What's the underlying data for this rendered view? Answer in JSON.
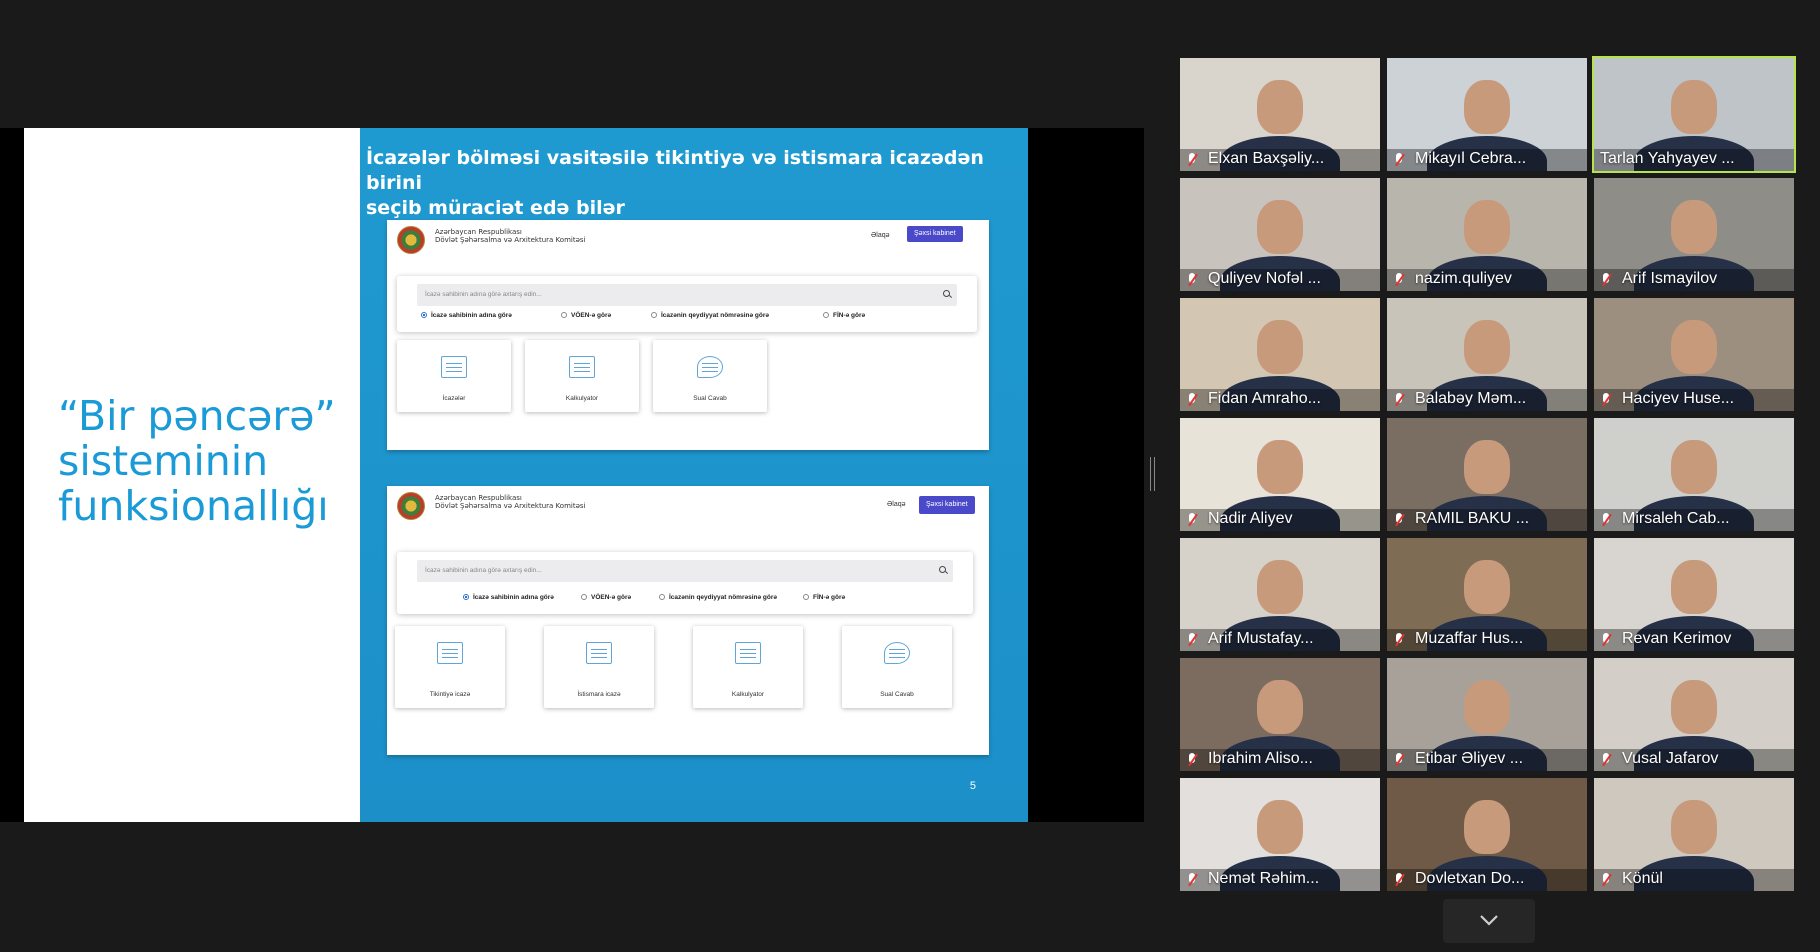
{
  "slide": {
    "title_lines": [
      "“Bir pəncərə”",
      "sisteminin",
      "funksionallığı"
    ],
    "heading_lines": [
      "İcazələr bölməsi vasitəsilə tikintiyə və istismara icazədən birini",
      "seçib müraciət edə bilər"
    ],
    "page_number": "5",
    "mock1": {
      "org_line1": "Azərbaycan Respublikası",
      "org_line2": "Dövlət Şəhərsalma və Arxitektura Komitəsi",
      "contact": "Əlaqə",
      "cabinet": "Şəxsi kabinet",
      "search_placeholder": "İcazə sahibinin adına görə axtarış edin...",
      "radios": [
        "İcazə sahibinin adına görə",
        "VÖEN-ə görə",
        "İcazənin qeydiyyat nömrəsinə görə",
        "FİN-ə görə"
      ],
      "tiles": [
        "İcazələr",
        "Kalkulyator",
        "Sual Cavab"
      ]
    },
    "mock2": {
      "org_line1": "Azərbaycan Respublikası",
      "org_line2": "Dövlət Şəhərsalma və Arxitektura Komitəsi",
      "contact": "Əlaqə",
      "cabinet": "Şəxsi kabinet",
      "search_placeholder": "İcazə sahibinin adına görə axtarış edin...",
      "radios": [
        "İcazə sahibinin adına görə",
        "VÖEN-ə görə",
        "İcazənin qeydiyyat nömrəsinə görə",
        "FİN-ə görə"
      ],
      "tiles": [
        "Tikintiyə icazə",
        "İstismara icazə",
        "Kalkulyator",
        "Sual Cavab"
      ]
    }
  },
  "participants": [
    {
      "name": "Elxan Baxşəliy...",
      "bg": "#d9d4cc",
      "muted": true
    },
    {
      "name": "Mikayıl Cebra...",
      "bg": "#cdd2d6",
      "muted": true
    },
    {
      "name": "Tarlan Yahyayev ...",
      "bg": "#bfc4c9",
      "muted": false,
      "active": true
    },
    {
      "name": "Quliyev Nofəl ...",
      "bg": "#c9c3bd",
      "muted": true
    },
    {
      "name": "nazim.quliyev",
      "bg": "#b8b6ac",
      "muted": true
    },
    {
      "name": "Arif Ismayilov",
      "bg": "#8f8d87",
      "muted": true
    },
    {
      "name": "Fidan Amraho...",
      "bg": "#d3c6b3",
      "muted": true
    },
    {
      "name": "Balabəy Məm...",
      "bg": "#c9c4ba",
      "muted": true
    },
    {
      "name": "Haciyev Huse...",
      "bg": "#9c8f80",
      "muted": true
    },
    {
      "name": "Nadir Aliyev",
      "bg": "#e8e3d8",
      "muted": true
    },
    {
      "name": "RAMIL BAKU ...",
      "bg": "#7a6e62",
      "muted": true
    },
    {
      "name": "Mirsaleh Cab...",
      "bg": "#cfd0cc",
      "muted": true
    },
    {
      "name": "Arif Mustafay...",
      "bg": "#d6d1c9",
      "muted": true
    },
    {
      "name": "Muzaffar Hus...",
      "bg": "#7f6c55",
      "muted": true
    },
    {
      "name": "Revan Kerimov",
      "bg": "#d8d5d0",
      "muted": true
    },
    {
      "name": "Ibrahim Aliso...",
      "bg": "#7b6c5f",
      "muted": true
    },
    {
      "name": "Etibar Əliyev ...",
      "bg": "#a7a19a",
      "muted": true
    },
    {
      "name": "Vusal Jafarov",
      "bg": "#d3cfc8",
      "muted": true
    },
    {
      "name": "Nemət Rəhim...",
      "bg": "#e2dfdc",
      "muted": true
    },
    {
      "name": "Dovletxan Do...",
      "bg": "#6e5a46",
      "muted": true
    },
    {
      "name": "Könül",
      "bg": "#cfc8bf",
      "muted": true
    }
  ],
  "colors": {
    "accent_active": "#b6e44b",
    "slide_blue": "#1f9ad0",
    "title_blue": "#1a9ad6",
    "button_purple": "#4a49c9"
  },
  "icons": {
    "muted_mic": "mic-off-icon",
    "more": "chevron-down-icon"
  }
}
